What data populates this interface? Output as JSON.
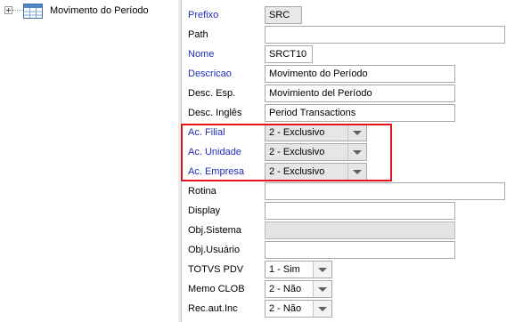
{
  "tree": {
    "label": "Movimento do Período"
  },
  "form": {
    "prefixo": {
      "label": "Prefixo",
      "value": "SRC"
    },
    "path": {
      "label": "Path",
      "value": ""
    },
    "nome": {
      "label": "Nome",
      "value": "SRCT10"
    },
    "descricao": {
      "label": "Descricao",
      "value": "Movimento do Período"
    },
    "desc_esp": {
      "label": "Desc. Esp.",
      "value": "Movimiento del Período"
    },
    "desc_ing": {
      "label": "Desc. Inglês",
      "value": "Period Transactions"
    },
    "ac_filial": {
      "label": "Ac. Filial",
      "value": "2 - Exclusivo"
    },
    "ac_unidade": {
      "label": "Ac. Unidade",
      "value": "2 - Exclusivo"
    },
    "ac_empresa": {
      "label": "Ac. Empresa",
      "value": "2 - Exclusivo"
    },
    "rotina": {
      "label": "Rotina",
      "value": ""
    },
    "display": {
      "label": "Display",
      "value": ""
    },
    "obj_sistema": {
      "label": "Obj.Sistema",
      "value": ""
    },
    "obj_usuario": {
      "label": "Obj.Usuário",
      "value": ""
    },
    "totvs_pdv": {
      "label": "TOTVS PDV",
      "value": "1 - Sim"
    },
    "memo_clob": {
      "label": "Memo CLOB",
      "value": "2 - Não"
    },
    "rec_aut": {
      "label": "Rec.aut.Inc",
      "value": "2 - Não"
    }
  },
  "colors": {
    "required_label": "#1f2dbf",
    "highlight": "#e3141a"
  }
}
